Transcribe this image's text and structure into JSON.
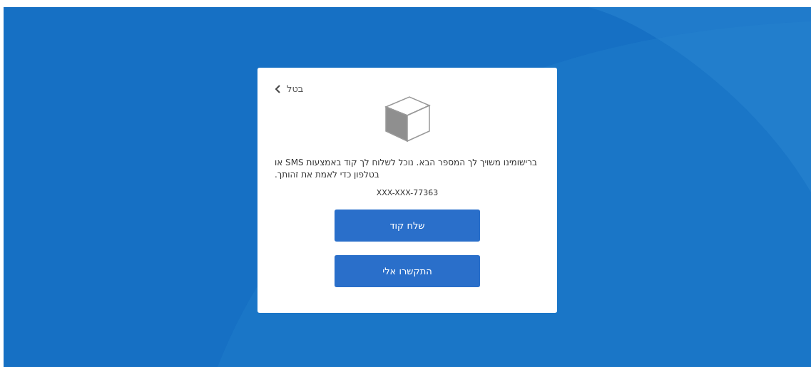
{
  "dialog": {
    "cancel_label": "בטל",
    "message": "ברישומינו משויך לך המספר הבא. נוכל לשלוח לך קוד באמצעות SMS או בטלפון כדי לאמת את זהותך.",
    "phone_number": "XXX-XXX-77363",
    "buttons": [
      "שלח קוד",
      "התקשרו אלי"
    ]
  }
}
